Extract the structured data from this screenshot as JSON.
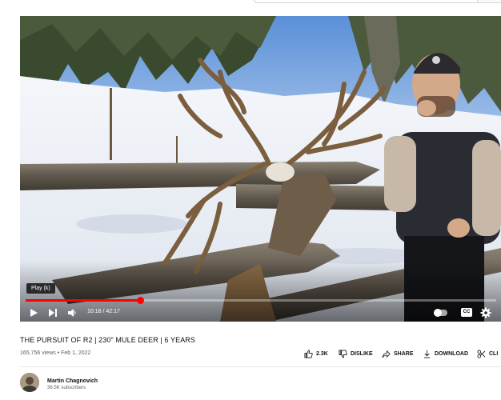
{
  "player": {
    "tooltip": "Play (k)",
    "time": "10:18 / 42:17",
    "progress": 0.243,
    "cc_label": "CC",
    "accent": "#ff0000",
    "icons": [
      "play-icon",
      "next-icon",
      "volume-icon",
      "autoplay-toggle-icon",
      "subtitles-icon",
      "settings-gear-icon"
    ]
  },
  "video": {
    "title": "THE PURSUIT OF R2 | 230\" MULE DEER | 6 YEARS",
    "meta": "165,756 views • Feb 1, 2022"
  },
  "actions": {
    "like": "2.3K",
    "dislike": "DISLIKE",
    "share": "SHARE",
    "download": "DOWNLOAD",
    "clip": "CLI"
  },
  "channel": {
    "name": "Martin Chagnovich",
    "subscribers": "36.5K subscribers"
  }
}
